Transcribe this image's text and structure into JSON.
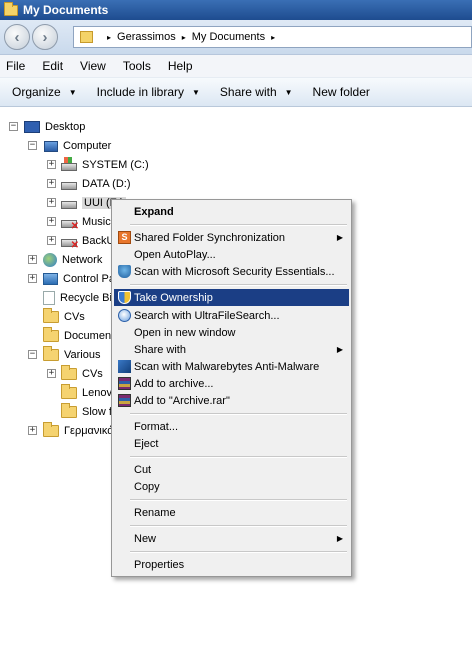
{
  "window": {
    "title": "My Documents"
  },
  "address": {
    "crumbs": [
      "Gerassimos",
      "My Documents"
    ],
    "sep": "▸"
  },
  "menubar": [
    "File",
    "Edit",
    "View",
    "Tools",
    "Help"
  ],
  "toolbar": {
    "organize": "Organize",
    "include_in_library": "Include in library",
    "share_with": "Share with",
    "new_folder": "New folder"
  },
  "tree": {
    "desktop": "Desktop",
    "computer": "Computer",
    "system_drive": "SYSTEM (C:)",
    "data_drive": "DATA (D:)",
    "uui_drive": "UUI (E:)",
    "music": "Music",
    "backup": "BackU",
    "network": "Network",
    "control_panel": "Control Pa",
    "recycle_bin": "Recycle Bi",
    "cvs": "CVs",
    "documents": "Document",
    "various": "Various",
    "various_cvs": "CVs",
    "lenovo": "Lenovo",
    "slow": "Slow f",
    "greek": "Γερμανικά"
  },
  "context_menu": {
    "expand": "Expand",
    "shared_folder_sync": "Shared Folder Synchronization",
    "open_autoplay": "Open AutoPlay...",
    "scan_mse": "Scan with Microsoft Security Essentials...",
    "take_ownership": "Take Ownership",
    "search_ultrafile": "Search with UltraFileSearch...",
    "open_new_window": "Open in new window",
    "share_with": "Share with",
    "scan_malwarebytes": "Scan with Malwarebytes Anti-Malware",
    "add_to_archive": "Add to archive...",
    "add_to_archive_rar": "Add to \"Archive.rar\"",
    "format": "Format...",
    "eject": "Eject",
    "cut": "Cut",
    "copy": "Copy",
    "rename": "Rename",
    "new": "New",
    "properties": "Properties"
  },
  "colors": {
    "menu_highlight": "#1b3e85",
    "title_bar": "#1e4c8f"
  }
}
